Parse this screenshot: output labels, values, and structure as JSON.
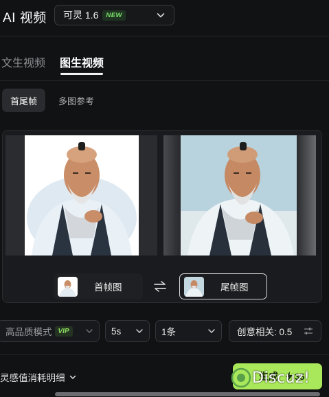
{
  "header": {
    "title": "AI 视频",
    "model_select": {
      "value": "可灵 1.6",
      "badge": "NEW"
    }
  },
  "tabs": [
    {
      "label": "文生视频",
      "active": false
    },
    {
      "label": "图生视频",
      "active": true
    }
  ],
  "subtabs": [
    {
      "label": "首尾帧",
      "active": true
    },
    {
      "label": "多图参考",
      "active": false
    }
  ],
  "frames": {
    "first_label": "首帧图",
    "last_label": "尾帧图"
  },
  "controls": {
    "quality": {
      "label": "高品质模式",
      "badge": "VIP"
    },
    "duration": {
      "value": "5s"
    },
    "count": {
      "value": "1条"
    },
    "creativity": {
      "label": "创意相关: 0.5"
    }
  },
  "footer": {
    "cost_label": "灵感值消耗明细",
    "generate": {
      "label": "生成",
      "cost": "35"
    }
  },
  "watermark": {
    "text": "Discuz!"
  },
  "colors": {
    "background": "#111214",
    "accent": "#a9e85a",
    "badge_green": "#7be36a"
  }
}
